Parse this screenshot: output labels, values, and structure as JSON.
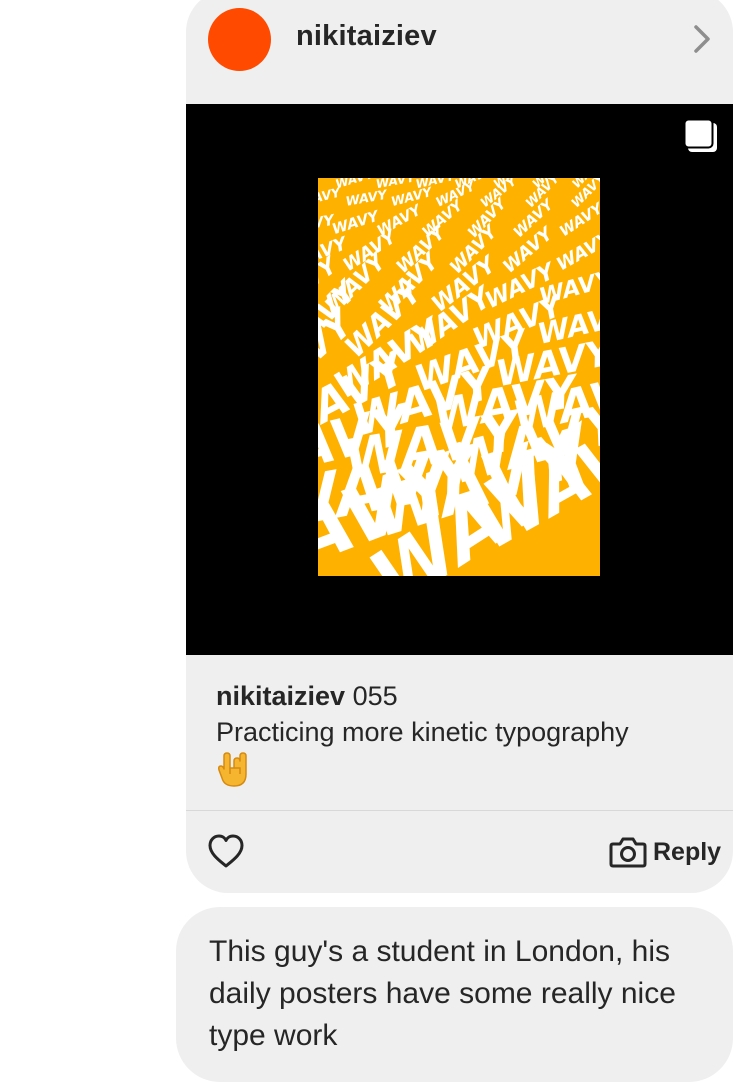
{
  "shared_post": {
    "username": "nikitaiziev",
    "avatar_color": "#ff4a00",
    "header_icon": "chevron-right-icon",
    "media": {
      "background_color": "#000000",
      "poster_color": "#ffb100",
      "poster_text": "WAVY",
      "multi_image_icon": "carousel-icon"
    },
    "caption": {
      "username": "nikitaiziev",
      "text_inline": "055",
      "text_line2": "Practicing more kinetic typography",
      "emoji": "🤘"
    },
    "actions": {
      "like_icon": "heart-icon",
      "reply_icon": "camera-icon",
      "reply_label": "Reply"
    }
  },
  "message": {
    "text": "This guy's a student in London, his daily posters have some really nice type work"
  }
}
